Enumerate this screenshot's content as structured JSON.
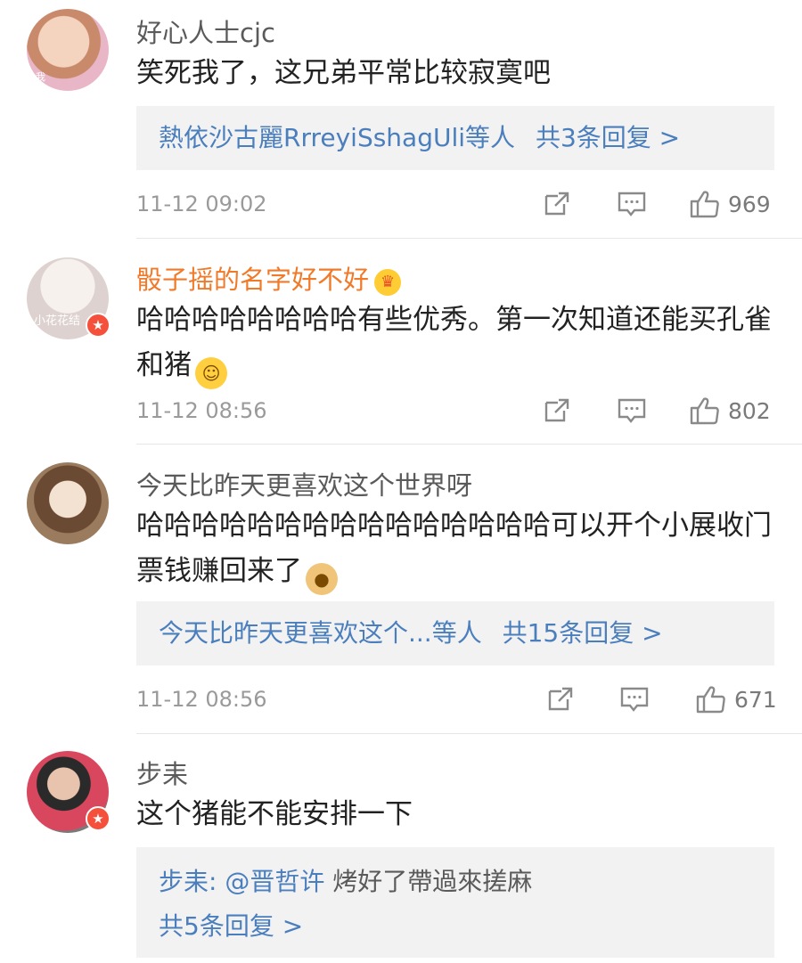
{
  "comments": [
    {
      "username": "好心人士cjc",
      "avatar_label": "我",
      "text": "笑死我了，这兄弟平常比较寂寞吧",
      "reply_prefix": "熱依沙古麗RrreyiSshagUli等人",
      "reply_count": "共3条回复 >",
      "time": "11-12 09:02",
      "likes": "969"
    },
    {
      "username": "骰子摇的名字好不好",
      "avatar_label": "小花花结",
      "text": "哈哈哈哈哈哈哈哈有些优秀。第一次知道还能买孔雀和猪",
      "time": "11-12 08:56",
      "likes": "802"
    },
    {
      "username": "今天比昨天更喜欢这个世界呀",
      "text": "哈哈哈哈哈哈哈哈哈哈哈哈哈哈哈可以开个小展收门票钱赚回来了",
      "reply_prefix": "今天比昨天更喜欢这个...等人",
      "reply_count": "共15条回复 >",
      "time": "11-12 08:56",
      "likes": "671"
    },
    {
      "username": "步耒",
      "text": "这个猪能不能安排一下",
      "reply_user": "步耒:",
      "reply_mention": "@晋哲许",
      "reply_text": "烤好了帶過來搓麻",
      "reply_count": "共5条回复 >"
    }
  ],
  "icons": {
    "share": "share-icon",
    "comment": "comment-icon",
    "like": "thumbs-up-icon",
    "verified": "verified-badge-icon",
    "crown": "crown-icon"
  },
  "colors": {
    "link": "#4a7ebd",
    "vip_name": "#f07a29",
    "badge": "#f5503b"
  }
}
